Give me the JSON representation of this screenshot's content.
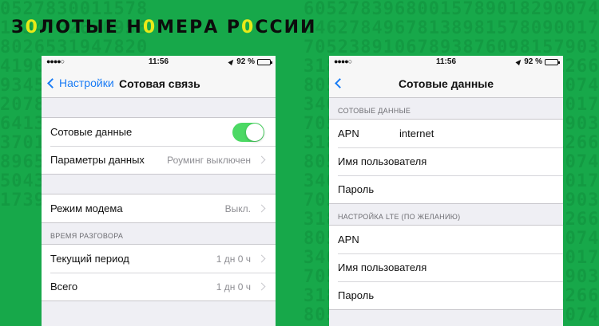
{
  "brand": {
    "pre": "З",
    "o1": "0",
    "mid1": "ЛОТЫЕ Н",
    "o2": "0",
    "mid2": "МЕРА Р",
    "o3": "0",
    "post": "ССИИ"
  },
  "left_phone": {
    "status": {
      "time": "11:56",
      "battery": "92 %",
      "battery_level": 0.92
    },
    "nav": {
      "back_label": "Настройки",
      "title": "Сотовая связь"
    },
    "group1": [
      {
        "label": "Сотовые данные",
        "toggle_on": true
      },
      {
        "label": "Параметры данных",
        "value": "Роуминг выключен"
      }
    ],
    "group2": [
      {
        "label": "Режим модема",
        "value": "Выкл."
      }
    ],
    "section_call_time": "ВРЕМЯ РАЗГОВОРА",
    "group3": [
      {
        "label": "Текущий период",
        "value": "1 дн 0 ч"
      },
      {
        "label": "Всего",
        "value": "1 дн 0 ч"
      }
    ]
  },
  "right_phone": {
    "status": {
      "time": "11:56",
      "battery": "92 %",
      "battery_level": 0.92
    },
    "nav": {
      "title": "Сотовые данные"
    },
    "section_cellular": "СОТОВЫЕ ДАННЫЕ",
    "cellular_rows": [
      {
        "label": "APN",
        "value": "internet"
      },
      {
        "label": "Имя пользователя"
      },
      {
        "label": "Пароль"
      }
    ],
    "section_lte": "НАСТРОЙКА LTE (ПО ЖЕЛАНИЮ)",
    "lte_rows": [
      {
        "label": "APN"
      },
      {
        "label": "Имя пользователя"
      },
      {
        "label": "Пароль"
      }
    ]
  },
  "colors": {
    "background": "#17a84a",
    "accent_blue": "#1a7cf5",
    "toggle_green": "#4cd964",
    "brand_highlight": "#e8ea18"
  }
}
